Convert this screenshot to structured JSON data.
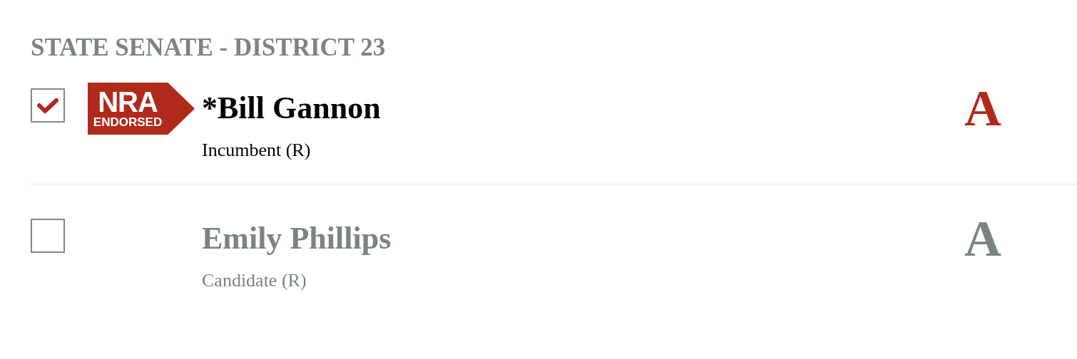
{
  "section_title": "STATE SENATE - DISTRICT 23",
  "candidates": [
    {
      "checked": true,
      "endorsement": {
        "line_1": "NRA",
        "line_2": "ENDORSED"
      },
      "name": "*Bill Gannon",
      "subtitle": "Incumbent (R)",
      "grade": "A"
    },
    {
      "checked": false,
      "name": "Emily Phillips",
      "subtitle": "Candidate (R)",
      "grade": "A"
    }
  ]
}
